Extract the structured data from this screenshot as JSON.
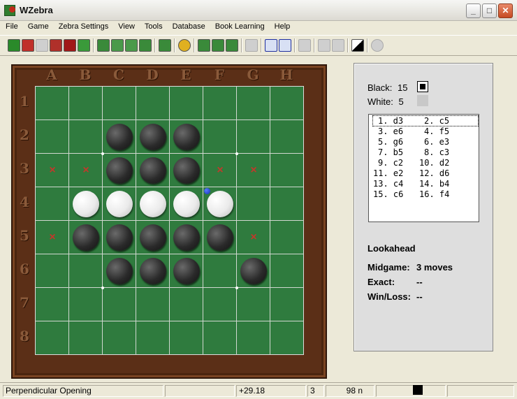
{
  "window": {
    "title": "WZebra"
  },
  "menu": [
    "File",
    "Game",
    "Zebra Settings",
    "View",
    "Tools",
    "Database",
    "Book Learning",
    "Help"
  ],
  "board": {
    "columns": [
      "A",
      "B",
      "C",
      "D",
      "E",
      "F",
      "G",
      "H"
    ],
    "rows": [
      "1",
      "2",
      "3",
      "4",
      "5",
      "6",
      "7",
      "8"
    ],
    "black_discs": [
      "c2",
      "d2",
      "e2",
      "c3",
      "d3",
      "e3",
      "b5",
      "c5",
      "d5",
      "e5",
      "f5",
      "c6",
      "d6",
      "e6",
      "g6"
    ],
    "white_discs": [
      "b4",
      "c4",
      "d4",
      "e4",
      "f4"
    ],
    "legal_move_marks": [
      "a3",
      "b3",
      "f3",
      "g3",
      "a5",
      "g5"
    ],
    "last_move": "f4",
    "colors": {
      "felt": "#2f7b3e",
      "frame": "#5b2f17",
      "mark": "#c0392b"
    }
  },
  "panel": {
    "black_label": "Black:",
    "black_count": "15",
    "white_label": "White:",
    "white_count": "5",
    "moves": [
      [
        "1. d3",
        "2. c5"
      ],
      [
        "3. e6",
        "4. f5"
      ],
      [
        "5. g6",
        "6. e3"
      ],
      [
        "7. b5",
        "8. c3"
      ],
      [
        "9. c2",
        "10. d2"
      ],
      [
        "11. e2",
        "12. d6"
      ],
      [
        "13. c4",
        "14. b4"
      ],
      [
        "15. c6",
        "16. f4"
      ]
    ],
    "lookahead_title": "Lookahead",
    "midgame_label": "Midgame:",
    "midgame_value": "3 moves",
    "exact_label": "Exact:",
    "exact_value": "--",
    "winloss_label": "Win/Loss:",
    "winloss_value": "--"
  },
  "status": {
    "opening": "Perpendicular Opening",
    "eval": "+29.18",
    "depth": "3",
    "nodes": "98 n"
  }
}
